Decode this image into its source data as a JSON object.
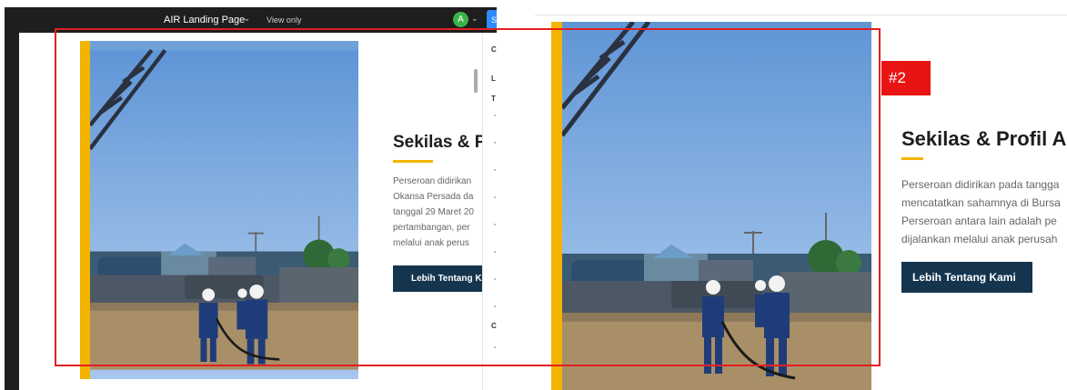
{
  "editor": {
    "title": "AIR Landing Page",
    "view_mode": "View only",
    "avatar_initial": "A",
    "share_label": "S",
    "side_labels": [
      "C",
      "L",
      "T",
      "C"
    ]
  },
  "section": {
    "heading_left": "Sekilas & P",
    "heading_right": "Sekilas & Profil A",
    "para_left": [
      "Perseroan didirikan",
      "Okansa Persada da",
      "tanggal 29 Maret 20",
      "pertambangan, per",
      "melalui anak perus"
    ],
    "para_right": [
      "Perseroan didirikan pada tangga",
      "mencatatkan sahamnya di Bursa",
      "Perseroan antara lain adalah pe",
      "dijalankan melalui anak perusah"
    ],
    "button_left": "Lebih Tentang K",
    "button_right": "Lebih Tentang Kami"
  },
  "annotation": {
    "label": "#2",
    "color": "#e81414"
  },
  "colors": {
    "accent_yellow": "#f2b400",
    "button_navy": "#15354f",
    "editor_dark": "#1e1e1e"
  }
}
